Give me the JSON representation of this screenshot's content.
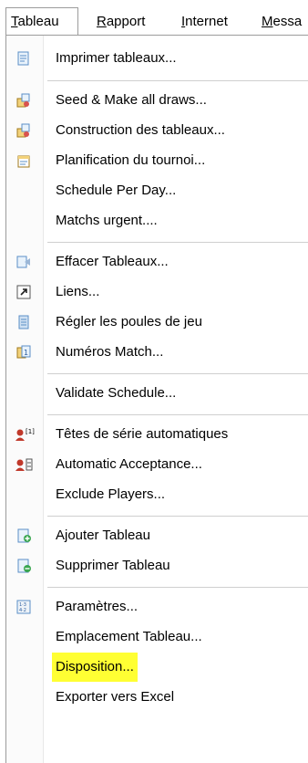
{
  "menubar": {
    "items": [
      {
        "pre": "",
        "u": "T",
        "post": "ableau"
      },
      {
        "pre": "",
        "u": "R",
        "post": "apport"
      },
      {
        "pre": "",
        "u": "I",
        "post": "nternet"
      },
      {
        "pre": "",
        "u": "M",
        "post": "essa"
      }
    ]
  },
  "menu": {
    "items": [
      {
        "label": "Imprimer tableaux...",
        "icon": "print-icon"
      },
      {
        "label": "Seed & Make all draws...",
        "icon": "seed-draws-icon"
      },
      {
        "label": "Construction des tableaux...",
        "icon": "build-draws-icon"
      },
      {
        "label": "Planification du tournoi...",
        "icon": "schedule-icon"
      },
      {
        "label": "Schedule Per Day...",
        "icon": ""
      },
      {
        "label": "Matchs urgent....",
        "icon": ""
      },
      {
        "label": "Effacer Tableaux...",
        "icon": "erase-icon"
      },
      {
        "label": "Liens...",
        "icon": "link-icon"
      },
      {
        "label": "Régler les poules de jeu",
        "icon": "pools-icon"
      },
      {
        "label": "Numéros Match...",
        "icon": "match-numbers-icon"
      },
      {
        "label": "Validate Schedule...",
        "icon": ""
      },
      {
        "label": "Têtes de série automatiques",
        "icon": "auto-seeds-icon"
      },
      {
        "label": "Automatic Acceptance...",
        "icon": "auto-acceptance-icon"
      },
      {
        "label": "Exclude Players...",
        "icon": ""
      },
      {
        "label": "Ajouter Tableau",
        "icon": "add-draw-icon"
      },
      {
        "label": "Supprimer Tableau",
        "icon": "delete-draw-icon"
      },
      {
        "label": "Paramètres...",
        "icon": "settings-icon"
      },
      {
        "label": "Emplacement Tableau...",
        "icon": ""
      },
      {
        "label": "Disposition...",
        "icon": ""
      },
      {
        "label": "Exporter vers Excel",
        "icon": ""
      }
    ],
    "icon_superscript": "[1]",
    "highlight_color": "#ffff33"
  }
}
